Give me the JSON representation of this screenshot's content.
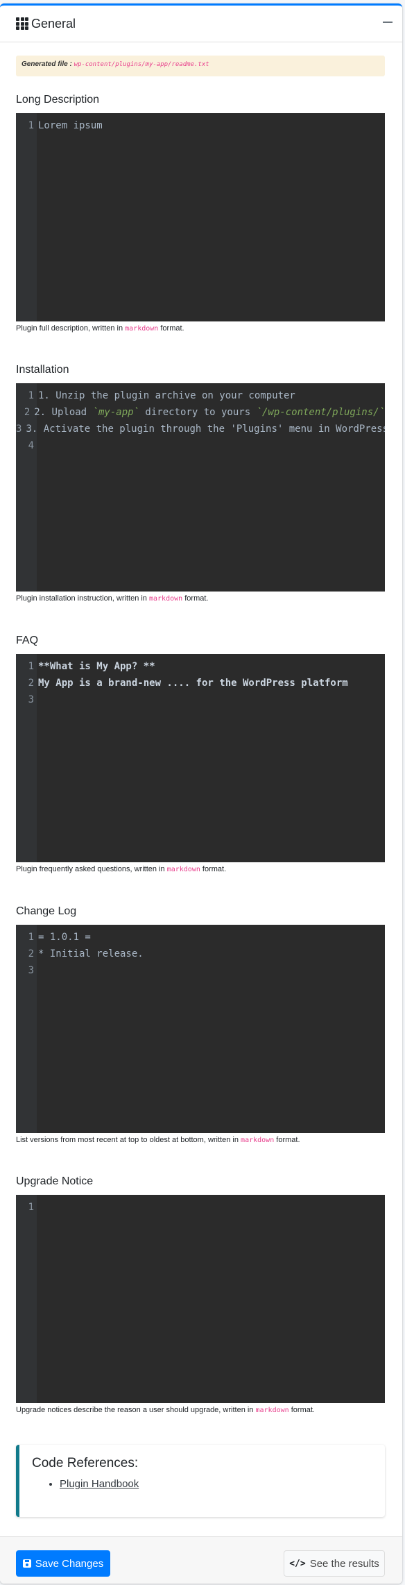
{
  "header": {
    "title": "General",
    "icon": "grid-icon",
    "collapse_icon": "minus-icon"
  },
  "alert": {
    "label": "Generated file :",
    "path": "wp-content/plugins/my-app/readme.txt"
  },
  "sections": {
    "long_description": {
      "label": "Long Description",
      "lines": [
        "Lorem ipsum"
      ],
      "help_prefix": "Plugin full description, written in",
      "help_code": "markdown",
      "help_suffix": "format."
    },
    "installation": {
      "label": "Installation",
      "line1": "1. Unzip the plugin archive on your computer",
      "line2_a": "2. Upload ",
      "line2_b": "`my-app`",
      "line2_c": " directory to yours ",
      "line2_d": "`/wp-content/plugins/`",
      "line3": "3. Activate the plugin through the 'Plugins' menu in WordPress",
      "help_prefix": "Plugin installation instruction, written in",
      "help_code": "markdown",
      "help_suffix": "format."
    },
    "faq": {
      "label": "FAQ",
      "line1": "**What is My App? **",
      "line2": "My App is a brand-new .... for the WordPress platform",
      "help_prefix": "Plugin frequently asked questions, written in",
      "help_code": "markdown",
      "help_suffix": "format."
    },
    "change_log": {
      "label": "Change Log",
      "line1": "= 1.0.1 =",
      "line2": "* Initial release.",
      "help_prefix": "List versions from most recent at top to oldest at bottom, written in",
      "help_code": "markdown",
      "help_suffix": "format."
    },
    "upgrade_notice": {
      "label": "Upgrade Notice",
      "help_prefix": "Upgrade notices describe the reason a user should upgrade, written in",
      "help_code": "markdown",
      "help_suffix": "format."
    }
  },
  "callout": {
    "title": "Code References:",
    "link": "Plugin Handbook"
  },
  "footer": {
    "save_label": "Save Changes",
    "results_label": "See the results"
  },
  "colors": {
    "primary": "#007bff",
    "editor_bg": "#2b2b2b",
    "alert_bg": "#faf1dc",
    "callout_border": "#117a8b"
  }
}
